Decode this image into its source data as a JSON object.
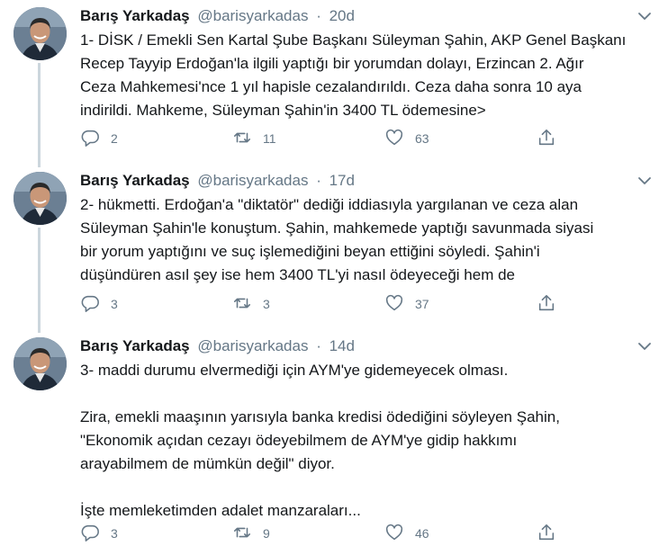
{
  "tweets": [
    {
      "name": "Barış Yarkadaş",
      "handle": "@barisyarkadas",
      "separator": "·",
      "time": "20d",
      "text": "1- DİSK / Emekli Sen Kartal Şube Başkanı Süleyman Şahin, AKP Genel Başkanı\nRecep Tayyip Erdoğan'la ilgili yaptığı bir yorumdan dolayı, Erzincan 2. Ağır\nCeza Mahkemesi'nce 1 yıl hapisle cezalandırıldı. Ceza daha sonra 10 aya\nindirildi. Mahkeme, Süleyman Şahin'in 3400 TL ödemesine>",
      "replies": "2",
      "retweets": "11",
      "likes": "63"
    },
    {
      "name": "Barış Yarkadaş",
      "handle": "@barisyarkadas",
      "separator": "·",
      "time": "17d",
      "text": "2- hükmetti. Erdoğan'a \"diktatör\" dediği iddiasıyla yargılanan ve ceza alan\nSüleyman Şahin'le konuştum. Şahin, mahkemede yaptığı savunmada siyasi\nbir yorum yaptığını ve suç işlemediğini beyan ettiğini söyledi. Şahin'i\ndüşündüren asıl şey ise hem 3400 TL'yi nasıl ödeyeceği hem de",
      "replies": "3",
      "retweets": "3",
      "likes": "37"
    },
    {
      "name": "Barış Yarkadaş",
      "handle": "@barisyarkadas",
      "separator": "·",
      "time": "14d",
      "text": "3- maddi durumu elvermediği için AYM'ye gidemeyecek olması.\n\nZira, emekli maaşının yarısıyla banka kredisi ödediğini söyleyen Şahin,\n\"Ekonomik açıdan cezayı ödeyebilmem de AYM'ye gidip hakkımı\narayabilmem de mümkün değil\" diyor.\n\nİşte memleketimden adalet manzaraları...",
      "replies": "3",
      "retweets": "9",
      "likes": "46"
    }
  ],
  "icons": {
    "reply": "reply-icon",
    "retweet": "retweet-icon",
    "like": "heart-icon",
    "share": "share-icon",
    "caret": "chevron-down-icon",
    "avatar": "avatar"
  },
  "colors": {
    "text": "#14171a",
    "muted": "#657786",
    "thread_line": "#ccd6dd"
  }
}
